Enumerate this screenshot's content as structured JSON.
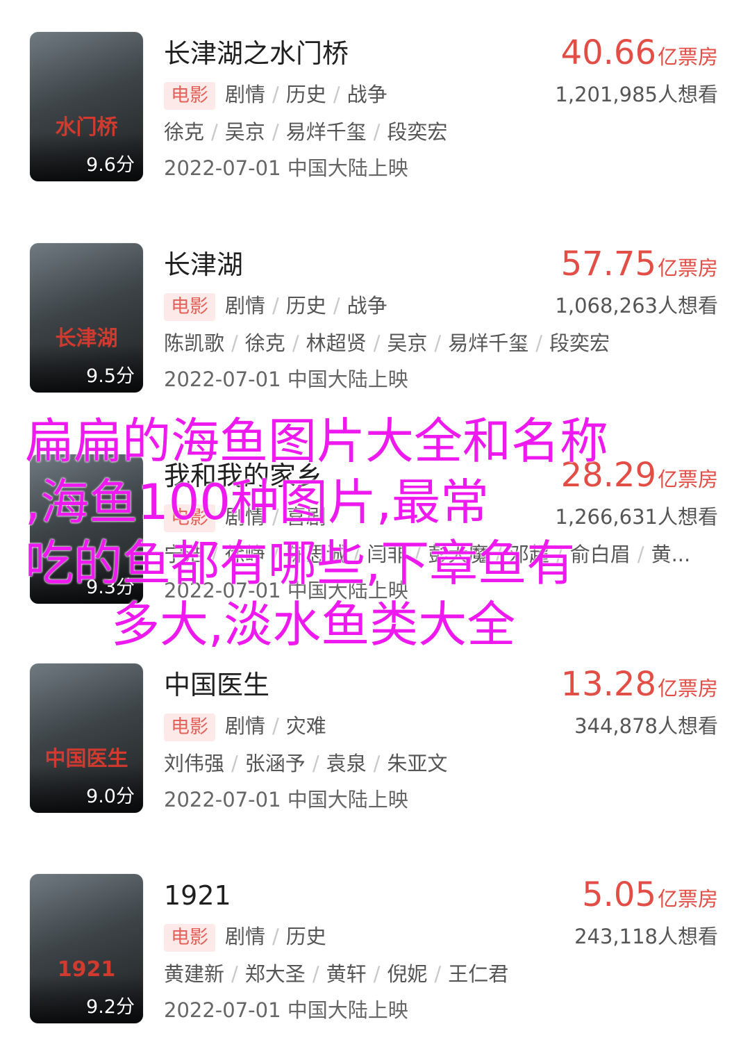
{
  "movies": [
    {
      "title": "长津湖之水门桥",
      "score": "9.6分",
      "poster_text": "水门桥",
      "box_office": "40.66",
      "box_unit": "亿票房",
      "tag": "电影",
      "genres": [
        "剧情",
        "历史",
        "战争"
      ],
      "want": "1,201,985人想看",
      "cast": [
        "徐克",
        "吴京",
        "易烊千玺",
        "段奕宏"
      ],
      "release": "2022-07-01 中国大陆上映"
    },
    {
      "title": "长津湖",
      "score": "9.5分",
      "poster_text": "长津湖",
      "box_office": "57.75",
      "box_unit": "亿票房",
      "tag": "电影",
      "genres": [
        "剧情",
        "历史",
        "战争"
      ],
      "want": "1,068,263人想看",
      "cast": [
        "陈凯歌",
        "徐克",
        "林超贤",
        "吴京",
        "易烊千玺",
        "段奕宏"
      ],
      "release": "2022-07-01 中国大陆上映"
    },
    {
      "title": "我和我的家乡",
      "score": "9.3分",
      "poster_text": "",
      "box_office": "28.29",
      "box_unit": "亿票房",
      "tag": "电影",
      "genres": [
        "剧情",
        "喜剧"
      ],
      "want": "1,266,631人想看",
      "cast": [
        "宁浩",
        "徐峥",
        "陈思诚",
        "闫非",
        "彭大魔",
        "邓超",
        "俞白眉",
        "黄..."
      ],
      "release": "2022-07-01 中国大陆上映"
    },
    {
      "title": "中国医生",
      "score": "9.0分",
      "poster_text": "中国医生",
      "box_office": "13.28",
      "box_unit": "亿票房",
      "tag": "电影",
      "genres": [
        "剧情",
        "灾难"
      ],
      "want": "344,878人想看",
      "cast": [
        "刘伟强",
        "张涵予",
        "袁泉",
        "朱亚文"
      ],
      "release": "2022-07-01 中国大陆上映"
    },
    {
      "title": "1921",
      "score": "9.2分",
      "poster_text": "1921",
      "box_office": "5.05",
      "box_unit": "亿票房",
      "tag": "电影",
      "genres": [
        "剧情",
        "历史"
      ],
      "want": "243,118人想看",
      "cast": [
        "黄建新",
        "郑大圣",
        "黄轩",
        "倪妮",
        "王仁君"
      ],
      "release": "2022-07-01 中国大陆上映"
    }
  ],
  "overlay": {
    "line1": "扁扁的海鱼图片大全和名称",
    "line2": ",海鱼100种图片,最常",
    "line3": "吃的鱼都有哪些,下章鱼有",
    "line4": "多大,淡水鱼类大全"
  },
  "colors": {
    "accent": "#e24d45",
    "tag_bg": "#fde9e7",
    "overlay_text": "#ee19ee"
  }
}
